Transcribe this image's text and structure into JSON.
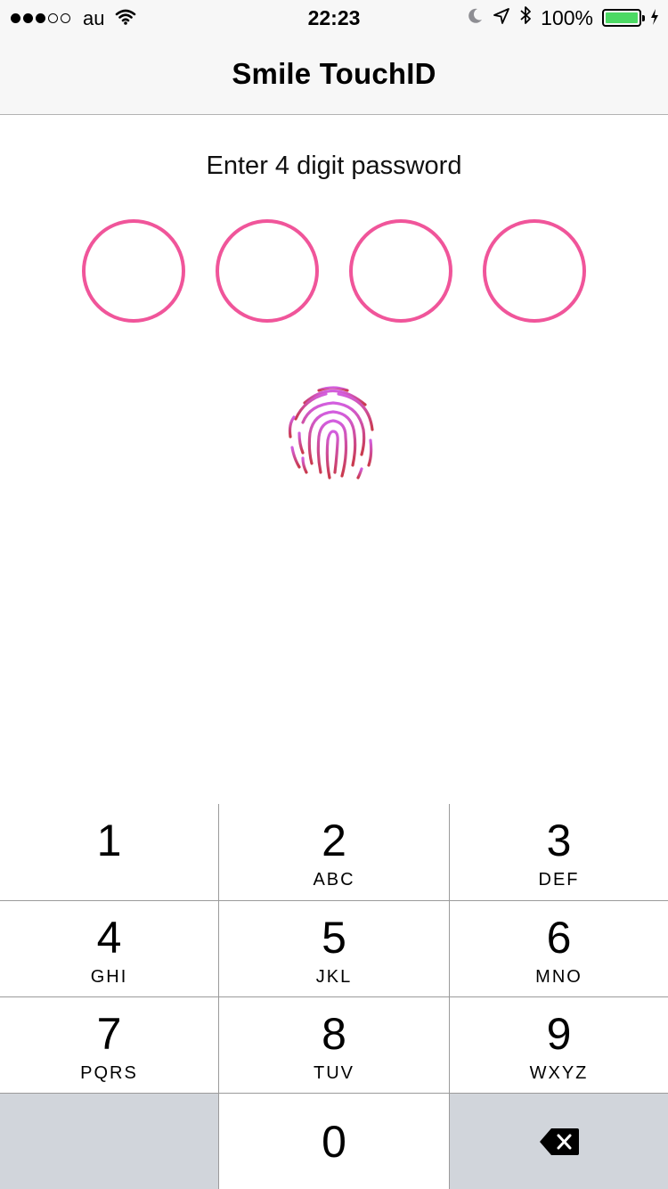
{
  "status_bar": {
    "carrier": "au",
    "time": "22:23",
    "battery_percent": "100%",
    "signal_bars_on": 3,
    "signal_bars_total": 5,
    "icons": [
      "wifi-icon",
      "moon-icon",
      "location-arrow-icon",
      "bluetooth-icon",
      "battery-icon",
      "charging-bolt-icon"
    ],
    "battery_color": "#4cd964"
  },
  "nav": {
    "title": "Smile TouchID"
  },
  "prompt": "Enter 4 digit password",
  "pin": {
    "length": 4,
    "entered": 0,
    "circle_color": "#f0559a"
  },
  "touch_id": {
    "icon": "fingerprint-icon",
    "gradient_top": "#d35fe0",
    "gradient_bottom": "#c9394a"
  },
  "keypad": {
    "keys": [
      {
        "number": "1",
        "letters": ""
      },
      {
        "number": "2",
        "letters": "ABC"
      },
      {
        "number": "3",
        "letters": "DEF"
      },
      {
        "number": "4",
        "letters": "GHI"
      },
      {
        "number": "5",
        "letters": "JKL"
      },
      {
        "number": "6",
        "letters": "MNO"
      },
      {
        "number": "7",
        "letters": "PQRS"
      },
      {
        "number": "8",
        "letters": "TUV"
      },
      {
        "number": "9",
        "letters": "WXYZ"
      },
      {
        "number": "0",
        "letters": ""
      }
    ],
    "delete_icon": "delete-backspace-icon",
    "gray_key_color": "#d1d5db"
  }
}
